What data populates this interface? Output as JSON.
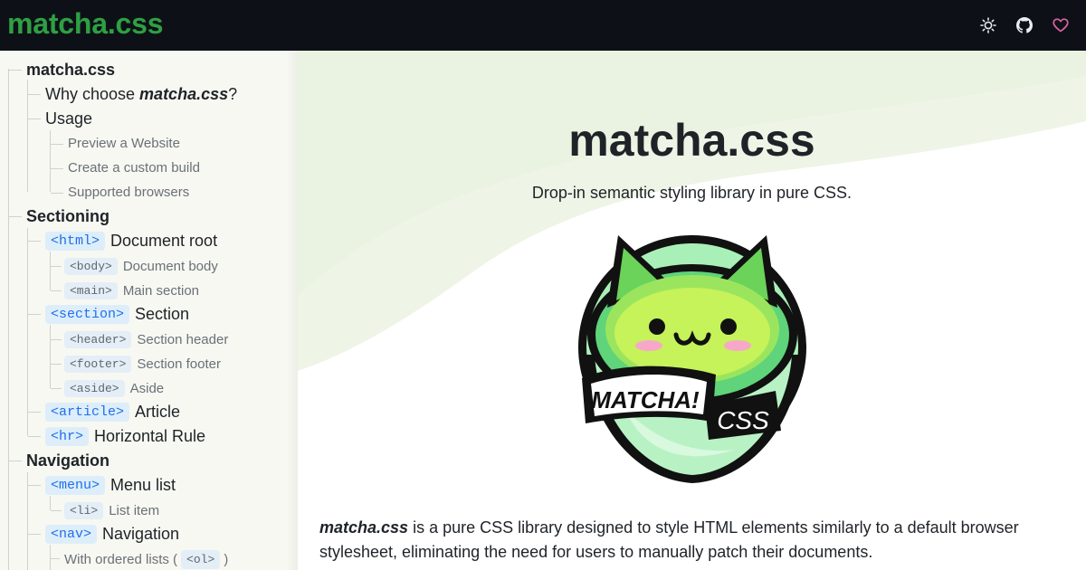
{
  "header": {
    "brand": "matcha.css",
    "icons": [
      "sun-icon",
      "github-icon",
      "heart-icon"
    ]
  },
  "sidebar": {
    "root": "matcha.css",
    "why_prefix": "Why choose ",
    "why_emph": "matcha.css",
    "why_suffix": "?",
    "usage": "Usage",
    "usage_children": [
      "Preview a Website",
      "Create a custom build",
      "Supported browsers"
    ],
    "sectioning": "Sectioning",
    "html_tag": "<html>",
    "html_label": "Document root",
    "body_tag": "<body>",
    "body_label": "Document body",
    "main_tag": "<main>",
    "main_label": "Main section",
    "section_tag": "<section>",
    "section_label": "Section",
    "header_tag": "<header>",
    "header_label": "Section header",
    "footer_tag": "<footer>",
    "footer_label": "Section footer",
    "aside_tag": "<aside>",
    "aside_label": "Aside",
    "article_tag": "<article>",
    "article_label": "Article",
    "hr_tag": "<hr>",
    "hr_label": "Horizontal Rule",
    "navigation": "Navigation",
    "menu_tag": "<menu>",
    "menu_label": "Menu list",
    "li_tag": "<li>",
    "li_label": "List item",
    "nav_tag": "<nav>",
    "nav_label": "Navigation",
    "ol_prefix": "With ordered lists (",
    "ol_tag": "<ol>",
    "ol_suffix": ")"
  },
  "main": {
    "title": "matcha.css",
    "subtitle": "Drop-in semantic styling library in pure CSS.",
    "mascot_banner": "MATCHA!",
    "mascot_css": "CSS",
    "intro_emph": "matcha.css",
    "intro_text": " is a pure CSS library designed to style HTML elements similarly to a default browser stylesheet, eliminating the need for users to manually patch their documents."
  },
  "colors": {
    "header_bg": "#0d1117",
    "brand": "#2ea043",
    "heart": "#db61a2",
    "tag_bg": "#ddeefa",
    "tag_text": "#1f6feb"
  }
}
